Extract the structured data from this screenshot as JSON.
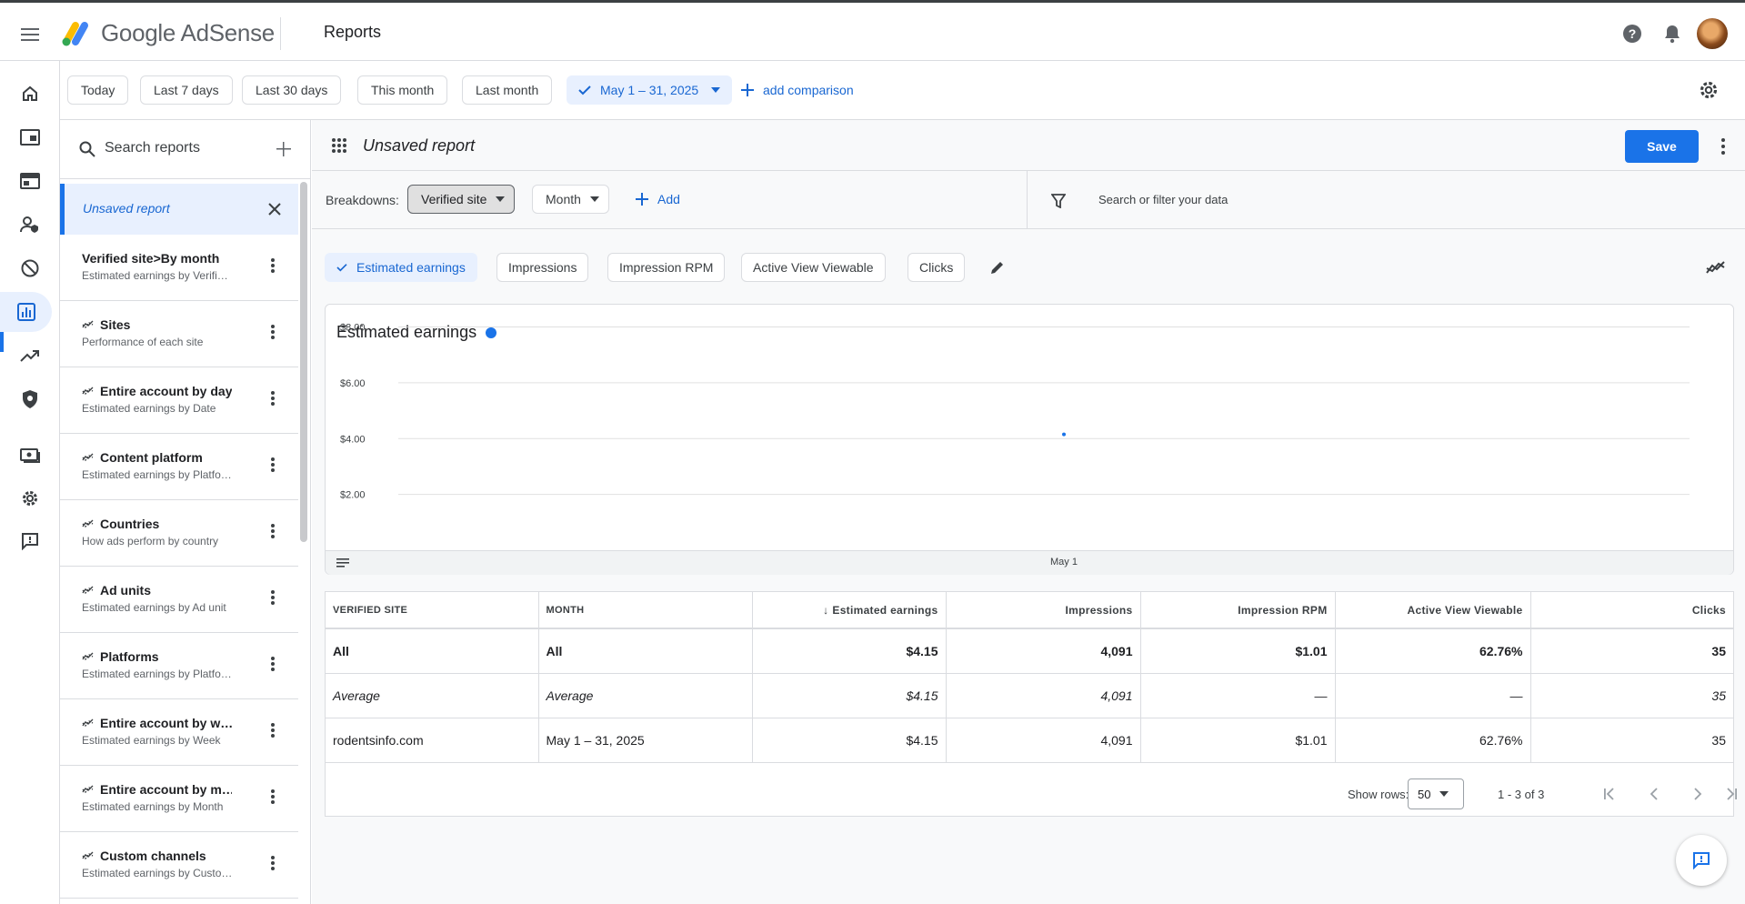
{
  "app": {
    "name": "Google AdSense",
    "page_title": "Reports"
  },
  "icons": {
    "menu": "menu-icon",
    "help": "help-icon",
    "notifications": "bell-icon",
    "settings": "gear-icon"
  },
  "colors": {
    "accent": "#1a73e8",
    "accent_text": "#1967d2",
    "selected_bg": "#e8f0fe"
  },
  "rail": [
    "home-icon",
    "ads-icon",
    "sites-icon",
    "privacy-messaging-icon",
    "blocking-controls-icon",
    "reports-icon",
    "optimization-icon",
    "policy-center-icon",
    "payments-icon",
    "settings-icon",
    "feedback-icon"
  ],
  "date_range": {
    "presets": [
      "Today",
      "Last 7 days",
      "Last 30 days",
      "This month",
      "Last month"
    ],
    "selected": "May 1 – 31, 2025",
    "add_comparison": "add comparison"
  },
  "sidebar": {
    "search_placeholder": "Search reports",
    "current": "Unsaved report",
    "reports": [
      {
        "title": "Verified site>By month",
        "subtitle": "Estimated earnings by Verifi…",
        "template": false
      },
      {
        "title": "Sites",
        "subtitle": "Performance of each site",
        "template": true
      },
      {
        "title": "Entire account by day",
        "subtitle": "Estimated earnings by Date",
        "template": true
      },
      {
        "title": "Content platform",
        "subtitle": "Estimated earnings by Platfo…",
        "template": true
      },
      {
        "title": "Countries",
        "subtitle": "How ads perform by country",
        "template": true
      },
      {
        "title": "Ad units",
        "subtitle": "Estimated earnings by Ad unit",
        "template": true
      },
      {
        "title": "Platforms",
        "subtitle": "Estimated earnings by Platfo…",
        "template": true
      },
      {
        "title": "Entire account by w…",
        "subtitle": "Estimated earnings by Week",
        "template": true
      },
      {
        "title": "Entire account by m…",
        "subtitle": "Estimated earnings by Month",
        "template": true
      },
      {
        "title": "Custom channels",
        "subtitle": "Estimated earnings by Custo…",
        "template": true
      }
    ]
  },
  "report": {
    "name": "Unsaved report",
    "save_label": "Save",
    "breakdowns_label": "Breakdowns:",
    "breakdowns": [
      "Verified site",
      "Month"
    ],
    "add_label": "Add",
    "filter_placeholder": "Search or filter your data",
    "metrics": [
      "Estimated earnings",
      "Impressions",
      "Impression RPM",
      "Active View Viewable",
      "Clicks"
    ],
    "selected_metric": "Estimated earnings"
  },
  "chart_data": {
    "type": "line",
    "title": "Estimated earnings",
    "categories": [
      "May 1"
    ],
    "series": [
      {
        "values": [
          4.15
        ]
      }
    ],
    "y_ticks": [
      "$8.00",
      "$6.00",
      "$4.00",
      "$2.00"
    ],
    "ylim": [
      0,
      8.8
    ],
    "grid": true
  },
  "table": {
    "columns": [
      "VERIFIED SITE",
      "MONTH",
      "Estimated earnings",
      "Impressions",
      "Impression RPM",
      "Active View Viewable",
      "Clicks"
    ],
    "rows": [
      [
        "All",
        "All",
        "$4.15",
        "4,091",
        "$1.01",
        "62.76%",
        "35"
      ],
      [
        "Average",
        "Average",
        "$4.15",
        "4,091",
        "—",
        "—",
        "35"
      ],
      [
        "rodentsinfo.com",
        "May 1 – 31, 2025",
        "$4.15",
        "4,091",
        "$1.01",
        "62.76%",
        "35"
      ]
    ],
    "show_rows_label": "Show rows:",
    "rows_per_page": "50",
    "range": "1 - 3 of 3"
  }
}
